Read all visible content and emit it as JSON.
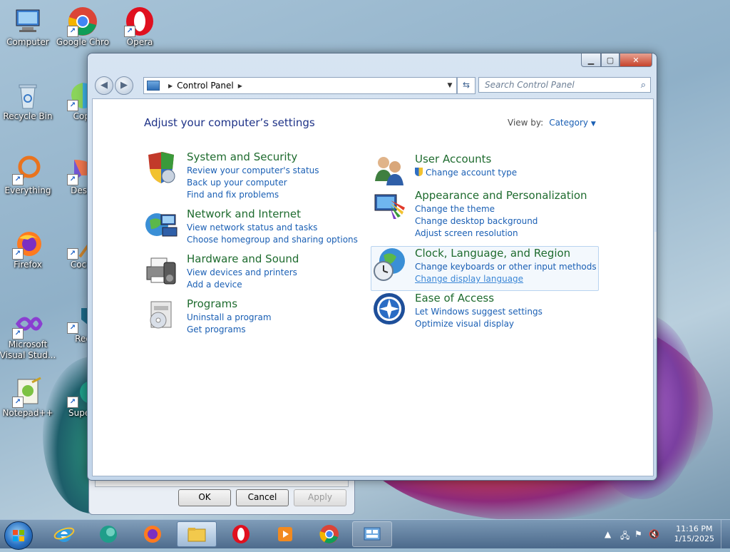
{
  "desktop": {
    "icons": [
      {
        "label": "Computer"
      },
      {
        "label": "Google Chro"
      },
      {
        "label": "Opera"
      },
      {
        "label": "Recycle Bin"
      },
      {
        "label": "Copi"
      },
      {
        "label": "Everything"
      },
      {
        "label": "Desig"
      },
      {
        "label": "Firefox"
      },
      {
        "label": "Cocre"
      },
      {
        "label": "Microsoft Visual Stud..."
      },
      {
        "label": "Rec"
      },
      {
        "label": "Notepad++"
      },
      {
        "label": "Superr"
      }
    ]
  },
  "back_dialog": {
    "ok_label": "OK",
    "cancel_label": "Cancel",
    "apply_label": "Apply"
  },
  "window": {
    "breadcrumb": "Control Panel",
    "search_placeholder": "Search Control Panel",
    "heading": "Adjust your computer’s settings",
    "view_by_label": "View by:",
    "view_by_value": "Category",
    "categories": [
      {
        "title": "System and Security",
        "icon": "shield-icon",
        "links": [
          "Review your computer's status",
          "Back up your computer",
          "Find and fix problems"
        ]
      },
      {
        "title": "Network and Internet",
        "icon": "network-globe-icon",
        "links": [
          "View network status and tasks",
          "Choose homegroup and sharing options"
        ]
      },
      {
        "title": "Hardware and Sound",
        "icon": "printer-icon",
        "links": [
          "View devices and printers",
          "Add a device"
        ]
      },
      {
        "title": "Programs",
        "icon": "programs-icon",
        "links": [
          "Uninstall a program",
          "Get programs"
        ]
      },
      {
        "title": "User Accounts",
        "icon": "users-icon",
        "links": [
          "Change account type"
        ]
      },
      {
        "title": "Appearance and Personalization",
        "icon": "appearance-icon",
        "links": [
          "Change the theme",
          "Change desktop background",
          "Adjust screen resolution"
        ]
      },
      {
        "title": "Clock, Language, and Region",
        "icon": "clock-globe-icon",
        "links": [
          "Change keyboards or other input methods",
          "Change display language"
        ]
      },
      {
        "title": "Ease of Access",
        "icon": "ease-of-access-icon",
        "links": [
          "Let Windows suggest settings",
          "Optimize visual display"
        ]
      }
    ]
  },
  "taskbar": {
    "time": "11:16 PM",
    "date": "1/15/2025",
    "apps": [
      "internet-explorer-icon",
      "app-icon",
      "firefox-icon",
      "file-explorer-icon",
      "opera-icon",
      "media-player-icon",
      "chrome-icon",
      "control-panel-icon"
    ]
  }
}
